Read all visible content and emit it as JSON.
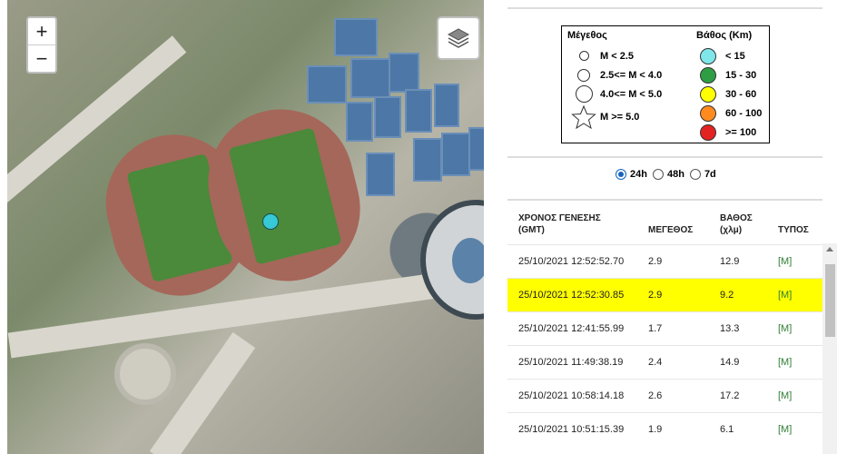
{
  "map": {
    "zoom_in": "+",
    "zoom_out": "−"
  },
  "legend": {
    "size_title": "Μέγεθος",
    "size_items": [
      "M < 2.5",
      "2.5<= M < 4.0",
      "4.0<= M < 5.0",
      "M >= 5.0"
    ],
    "depth_title": "Βάθος (Km)",
    "depth_items": [
      {
        "label": "< 15",
        "color": "#7fe6ea"
      },
      {
        "label": "15 - 30",
        "color": "#2e9e44"
      },
      {
        "label": "30 - 60",
        "color": "#ffff00"
      },
      {
        "label": "60 - 100",
        "color": "#ff8a1f"
      },
      {
        "label": ">= 100",
        "color": "#e32222"
      }
    ]
  },
  "period": {
    "options": [
      "24h",
      "48h",
      "7d"
    ],
    "selected": "24h"
  },
  "table": {
    "headers": {
      "time": "ΧΡΟΝΟΣ ΓΕΝΕΣΗΣ",
      "time_sub": "(GMT)",
      "mag": "ΜΕΓΕΘΟΣ",
      "depth": "ΒΑΘΟΣ",
      "depth_sub": "(χλμ)",
      "type": "ΤΥΠΟΣ"
    },
    "rows": [
      {
        "time": "25/10/2021 12:52:52.70",
        "mag": "2.9",
        "depth": "12.9",
        "type": "[M]"
      },
      {
        "time": "25/10/2021 12:52:30.85",
        "mag": "2.9",
        "depth": "9.2",
        "type": "[M]"
      },
      {
        "time": "25/10/2021 12:41:55.99",
        "mag": "1.7",
        "depth": "13.3",
        "type": "[M]"
      },
      {
        "time": "25/10/2021 11:49:38.19",
        "mag": "2.4",
        "depth": "14.9",
        "type": "[M]"
      },
      {
        "time": "25/10/2021 10:58:14.18",
        "mag": "2.6",
        "depth": "17.2",
        "type": "[M]"
      },
      {
        "time": "25/10/2021 10:51:15.39",
        "mag": "1.9",
        "depth": "6.1",
        "type": "[M]"
      }
    ]
  }
}
